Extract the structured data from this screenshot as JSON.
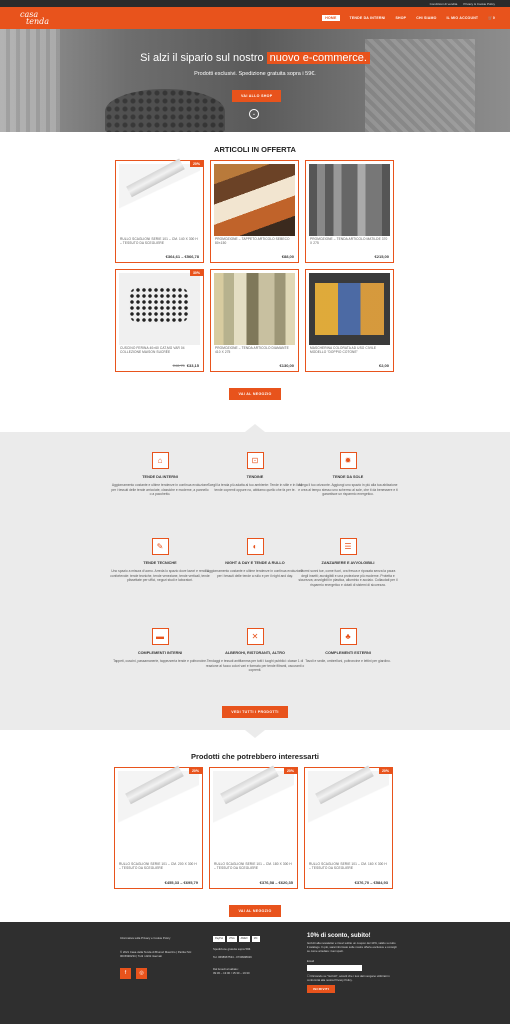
{
  "topbar": {
    "links": [
      "Condizioni di vendita",
      "Privacy & Cookie Policy"
    ]
  },
  "nav": {
    "logo_line1": "casa",
    "logo_line2": "tenda",
    "items": [
      "HOME",
      "TENDE DA INTERNI",
      "SHOP",
      "CHI SIAMO",
      "IL MIO ACCOUNT"
    ],
    "cart": "0"
  },
  "hero": {
    "headline": "Si alzi il sipario sul nostro",
    "highlight": "nuovo e-commerce.",
    "sub": "Prodotti esclusivi. Spedizione gratuita sopra i 59€.",
    "button": "VAI ALLO SHOP"
  },
  "offers": {
    "title": "ARTICOLI IN OFFERTA",
    "products": [
      {
        "title": "RULLO SCAGLIONI SERIE 101 – CM. 140 X 300 H – TESSUTO DA SCEGLIERE",
        "price": "€364,61 – €566,78",
        "old": "",
        "badge": "20%",
        "image": "rail"
      },
      {
        "title": "PROMOZIONE – TAPPETO ARTICOLO SEBECO 80×150",
        "price": "€88,00",
        "old": "",
        "badge": "",
        "image": "stripes"
      },
      {
        "title": "PROMOZIONE – TENDA ARTICOLO MATILDE 370 X 275",
        "price": "€215,00",
        "old": "",
        "badge": "",
        "image": "curtain"
      },
      {
        "title": "CUSCINO FERINA 40×60 CAT.MG VAR 04 COLLEZIONE MAISON SUCRÉE",
        "price": "€33,15",
        "old": "€48,75",
        "badge": "30%",
        "image": "pillow2"
      },
      {
        "title": "PROMOZIONE – TENDA ARTICOLO DIAMANTE 410 X 275",
        "price": "€130,00",
        "old": "",
        "badge": "",
        "image": "room"
      },
      {
        "title": "MASCHERINA COLORATA AD USO CIVILE MODELLO \"DOPPIO COTONE\"",
        "price": "€2,00",
        "old": "",
        "badge": "",
        "image": "masks"
      }
    ],
    "button": "VAI AL NEGOZIO"
  },
  "services": {
    "items": [
      {
        "title": "TENDE DA INTERNI",
        "icon": "home-icon",
        "glyph": "⌂",
        "text": "Aggiornamento costante e ultime tendenze in continua evoluzione per i tessuti delle tende arricciate, classiche e moderne, a pannello o a pacchetto."
      },
      {
        "title": "TENDINE",
        "icon": "crop-icon",
        "glyph": "⊡",
        "text": "Scegli la tenda più adatta al tuo ambiente: Tende in stile e in lino, tende coprenti oppure no, abbiamo quello che fa per te."
      },
      {
        "title": "TENDE DA SOLE",
        "icon": "sun-icon",
        "glyph": "✹",
        "text": "Allega il tuo orizzonte. Aggiungi uno spazio in più alla tua abitazione e crea al tempo stesso uno schermo al sole, che ti da benessere e ti garantisce un risparmio energetico."
      },
      {
        "title": "TENDE TECNICHE",
        "icon": "edit-icon",
        "glyph": "✎",
        "text": "Uno spazio a misura d'uomo. Arreda lo spazio dove lavori e rendilo confortevole: tende tecniche, tende veneziane, tende verticali, tende plissettate per uffici, negozi studi e laboratori."
      },
      {
        "title": "NIGHT & DAY E TENDE A RULLO",
        "icon": "contrast-icon",
        "glyph": "◐",
        "text": "Aggiornamento costante e ultime tendenze in continua evoluzione per i tessuti delle tende a rullo e per il night and day."
      },
      {
        "title": "ZANZARIERE E AVVOLGIBILI",
        "icon": "blinds-icon",
        "glyph": "☰",
        "text": "Dormi sonni tue, come fuori, ora fresca e riposata senza la paura degli insetti; avvolgibili e una protezione più moderne. Protetta e sicurezza; avvolgibili in plastica, alluminio e acciaio. Collaudati per il risparmio energetico e dotati di sistemi di sicurezza."
      },
      {
        "title": "COMPLEMENTI INTERNI",
        "icon": "bed-icon",
        "glyph": "▬",
        "text": "Tappeti, cuscini, passamanerie, tappezzeria tende e poltroncine."
      },
      {
        "title": "ALBERGHI, RISTORANTI, ALTRO",
        "icon": "restaurant-icon",
        "glyph": "🍴",
        "text": "Tendaggi e tessuti antifiamma per tutti i luoghi pubblici: classe 1 di reazione al fuoco colori vari e formato per tende filtranti, oscuranti o coprenti."
      },
      {
        "title": "COMPLEMENTI ESTERNI",
        "icon": "tree-icon",
        "glyph": "♣",
        "text": "Tavoli e sedie, ombrelloni, poltroncine e lettini per giardino."
      }
    ],
    "button": "VEDI TUTTI I PRODOTTI"
  },
  "related": {
    "title": "Prodotti che potrebbero interessarti",
    "products": [
      {
        "title": "RULLO SCAGLIONI SERIE 101 – CM. 200 X 300 H – TESSUTO DA SCEGLIERE",
        "price": "€455,33 – €695,79",
        "badge": "20%"
      },
      {
        "title": "RULLO SCAGLIONI SERIE 101 – CM. 180 X 300 H – TESSUTO DA SCEGLIERE",
        "price": "€376,58 – €620,35",
        "badge": "20%"
      },
      {
        "title": "RULLO SCAGLIONI SERIE 101 – CM. 160 X 300 H – TESSUTO DA SCEGLIERE",
        "price": "€376,70 – €584,93",
        "badge": "20%"
      }
    ],
    "button": "VAI AL NEGOZIO"
  },
  "footer": {
    "policy": "Informativa sulla Privacy e Cookie Policy",
    "company": "© 2021 Casa della Tenda di Brunori Maurizio | Partita IVA: 0015990234 | Tutti i diritti riservati",
    "payments": [
      "PayPal",
      "VISA",
      "AMEX",
      "MC"
    ],
    "shipping": "Spedizione gratuita sopra 59€.",
    "phone": "Tel. 0698967534 - 0739998029",
    "hours_label": "Dal lunedì al sabato:",
    "hours": "09:30 – 13:00 / 15:30 – 19:30",
    "newsletter_title": "10% di sconto, subito!",
    "newsletter_text": "Iscriviti alla newsletter e ricevi subito un coupon del 10%, valido su tutto il catalogo. In più, sarai informato sulle nostre offerte esclusive e consigli su come arredare i tuoi spazi.",
    "email_label": "Email",
    "consent": "Cliccando su \"Iscriviti\", accetti che i tuoi dati vengano utilizzati in conformità alla nostra Privacy Policy.",
    "submit": "ISCRIVITI"
  },
  "colors": {
    "accent": "#e8531c",
    "dark": "#2f2f2f",
    "band": "#ebebeb"
  }
}
